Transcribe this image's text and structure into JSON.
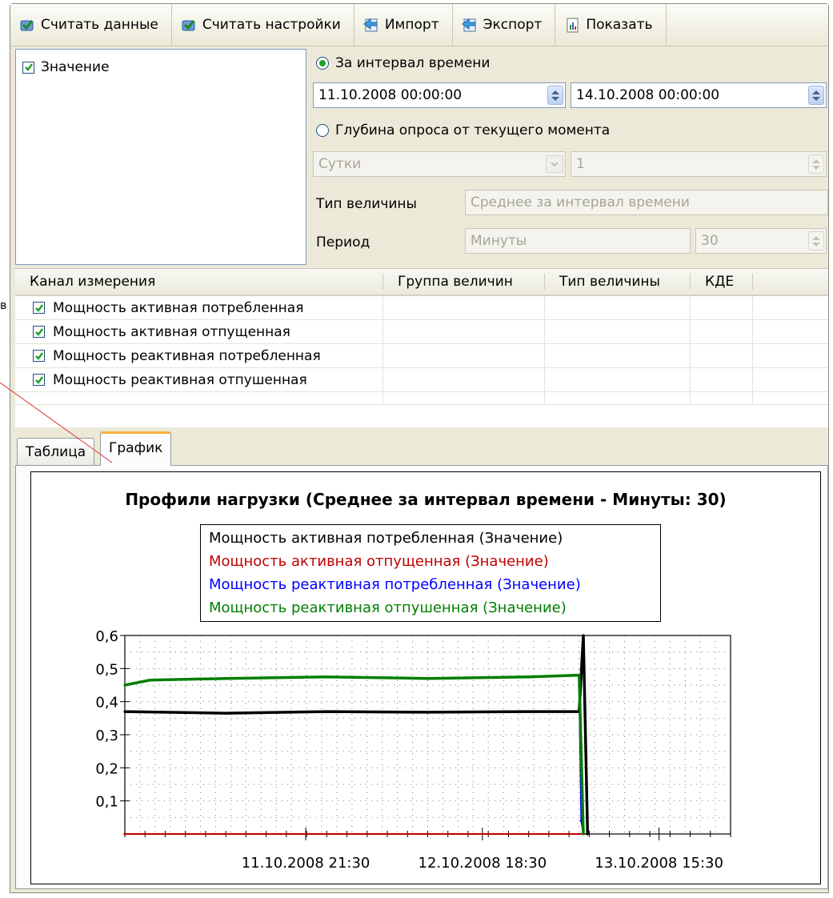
{
  "toolbar": {
    "buttons": [
      {
        "label": "Считать данные",
        "icon": "read-data-icon"
      },
      {
        "label": "Считать настройки",
        "icon": "read-settings-icon"
      },
      {
        "label": "Импорт",
        "icon": "import-icon"
      },
      {
        "label": "Экспорт",
        "icon": "export-icon"
      },
      {
        "label": "Показать",
        "icon": "show-icon"
      }
    ]
  },
  "params": {
    "value_checkbox_label": "Значение",
    "interval_radio_label": "За интервал времени",
    "date_from": "11.10.2008 00:00:00",
    "date_to": "14.10.2008 00:00:00",
    "depth_radio_label": "Глубина опроса от текущего момента",
    "depth_unit": "Сутки",
    "depth_value": "1",
    "value_type_label": "Тип величины",
    "value_type": "Среднее за интервал времени",
    "period_label": "Период",
    "period_unit": "Минуты",
    "period_value": "30"
  },
  "channels": {
    "columns": [
      "Канал измерения",
      "Группа величин",
      "Тип величины",
      "КДЕ"
    ],
    "rows": [
      "Мощность активная потребленная",
      "Мощность активная отпущенная",
      "Мощность реактивная потребленная",
      "Мощность реактивная отпушенная"
    ]
  },
  "tabs": {
    "table": "Таблица",
    "chart": "График"
  },
  "colors": {
    "series_black": "#000000",
    "series_red": "#c00000",
    "series_blue": "#0000ff",
    "series_green": "#007f00",
    "tab_accent": "#f6b03c"
  },
  "chart_data": {
    "type": "line",
    "title": "Профили нагрузки (Среднее за интервал времени - Минуты: 30)",
    "ylim": [
      0,
      0.6
    ],
    "yticks": [
      "0,6",
      "0,5",
      "0,4",
      "0,3",
      "0,2",
      "0,1"
    ],
    "xticks": [
      "11.10.2008 21:30",
      "12.10.2008 18:30",
      "13.10.2008 15:30"
    ],
    "grid": true,
    "legend_position": "top-center",
    "series": [
      {
        "name": "Мощность активная потребленная (Значение)",
        "color": "#000000",
        "points": [
          [
            "11.10.2008 00:00",
            0.37
          ],
          [
            "11.10.2008 12:00",
            0.365
          ],
          [
            "12.10.2008 00:00",
            0.37
          ],
          [
            "12.10.2008 12:00",
            0.368
          ],
          [
            "13.10.2008 00:00",
            0.37
          ],
          [
            "13.10.2008 06:00",
            0.37
          ],
          [
            "13.10.2008 06:30",
            0.6
          ],
          [
            "13.10.2008 07:00",
            0.0
          ]
        ]
      },
      {
        "name": "Мощность активная отпущенная (Значение)",
        "color": "#c00000",
        "points": [
          [
            "11.10.2008 00:00",
            0.0
          ],
          [
            "13.10.2008 07:00",
            0.0
          ]
        ]
      },
      {
        "name": "Мощность реактивная потребленная (Значение)",
        "color": "#0000ff",
        "points": [
          [
            "13.10.2008 06:00",
            0.45
          ],
          [
            "13.10.2008 06:15",
            0.04
          ],
          [
            "13.10.2008 06:30",
            0.0
          ]
        ]
      },
      {
        "name": "Мощность реактивная отпушенная (Значение)",
        "color": "#007f00",
        "points": [
          [
            "11.10.2008 00:00",
            0.45
          ],
          [
            "11.10.2008 03:00",
            0.465
          ],
          [
            "11.10.2008 12:00",
            0.47
          ],
          [
            "12.10.2008 00:00",
            0.475
          ],
          [
            "12.10.2008 12:00",
            0.47
          ],
          [
            "13.10.2008 00:00",
            0.475
          ],
          [
            "13.10.2008 06:00",
            0.48
          ],
          [
            "13.10.2008 06:30",
            0.0
          ]
        ]
      }
    ]
  }
}
